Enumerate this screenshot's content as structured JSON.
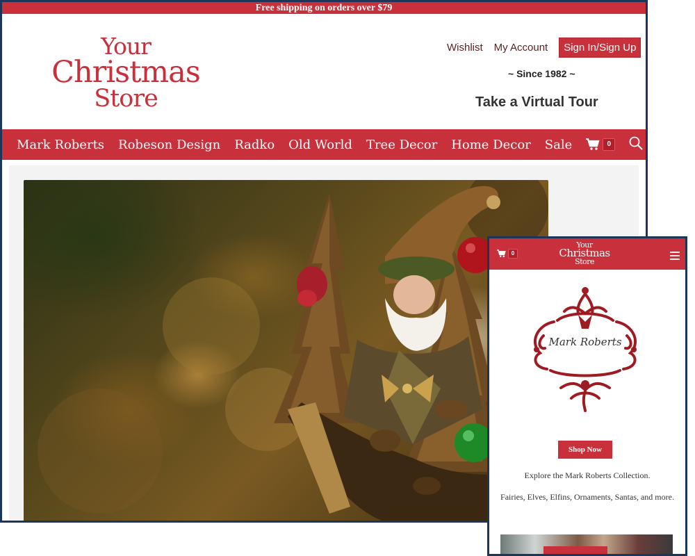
{
  "desktop": {
    "promo": "Free shipping on orders over $79",
    "logo": {
      "line1": "Your",
      "line2": "Christmas",
      "line3": "Store"
    },
    "links": {
      "wishlist": "Wishlist",
      "account": "My Account",
      "signin": "Sign In/Sign Up"
    },
    "since": "~ Since 1982 ~",
    "tour": "Take a Virtual Tour",
    "nav": [
      "Mark Roberts",
      "Robeson Design",
      "Radko",
      "Old World",
      "Tree Decor",
      "Home Decor",
      "Sale"
    ],
    "cart_count": "0",
    "icons": {
      "cart": "cart-icon",
      "search": "search-icon"
    },
    "hero_alt": "Santa figurine with pinecone trees"
  },
  "mobile": {
    "logo": {
      "line1": "Your",
      "line2": "Christmas",
      "line3": "Store"
    },
    "cart_count": "0",
    "brand_name": "Mark Roberts",
    "shop_now": "Shop Now",
    "text1": "Explore the Mark Roberts Collection.",
    "text2": "Fairies, Elves, Elfins, Ornaments, Santas, and more.",
    "icons": {
      "cart": "cart-icon",
      "menu": "hamburger-menu-icon"
    }
  },
  "colors": {
    "brand_red": "#c8313b",
    "frame_navy": "#1c3559"
  }
}
